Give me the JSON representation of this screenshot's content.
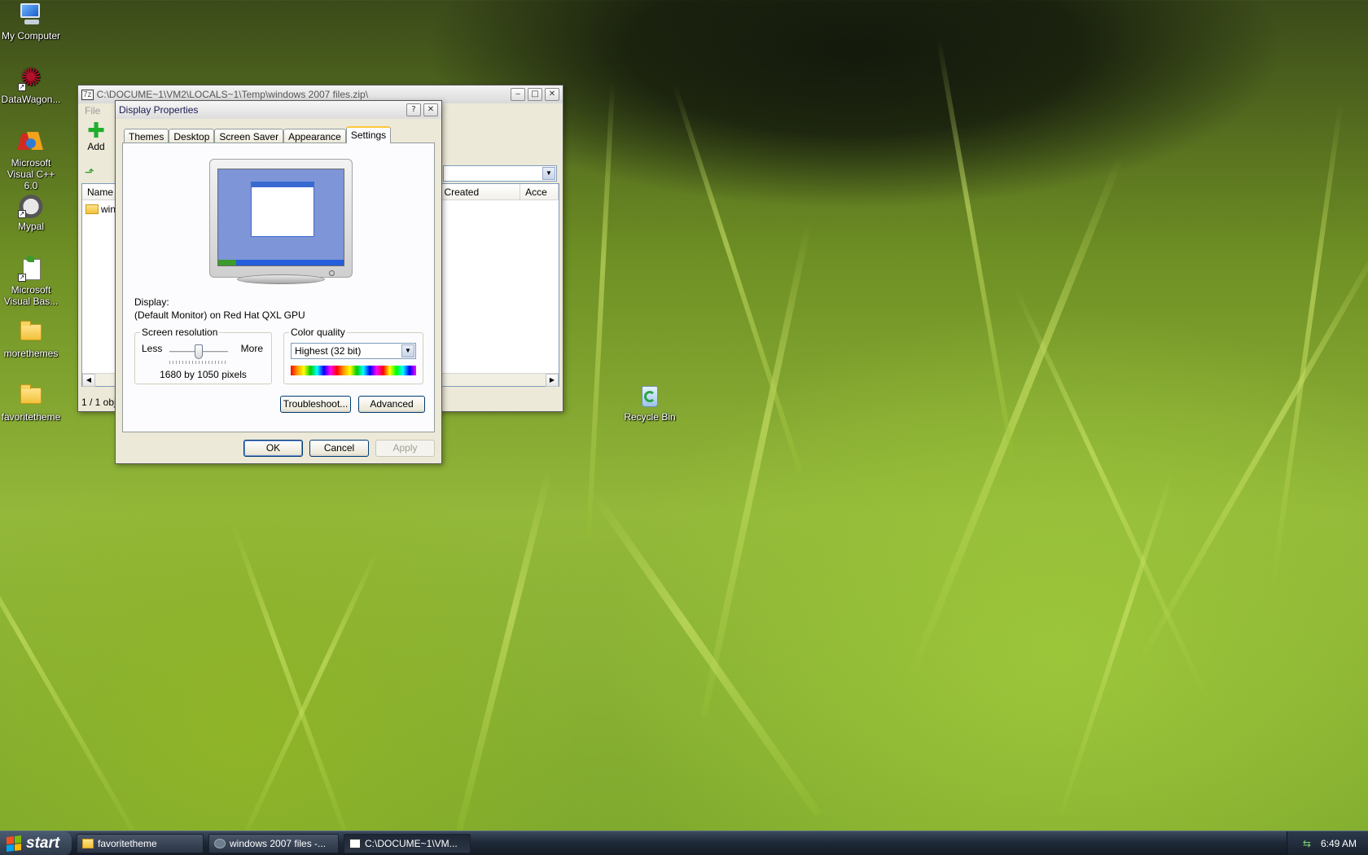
{
  "desktop": {
    "icons": [
      {
        "label": "My Computer",
        "icon": "computer-icon"
      },
      {
        "label": "DataWagon...",
        "icon": "datawagon-icon"
      },
      {
        "label": "Microsoft Visual C++ 6.0",
        "icon": "visual-cpp-icon"
      },
      {
        "label": "Mypal",
        "icon": "mypal-icon"
      },
      {
        "label": "Microsoft Visual Bas...",
        "icon": "visual-basic-icon"
      },
      {
        "label": "morethemes",
        "icon": "folder-icon"
      },
      {
        "label": "favoritetheme",
        "icon": "folder-icon"
      },
      {
        "label": "Recycle Bin",
        "icon": "recycle-bin-icon"
      }
    ]
  },
  "zip_window": {
    "title": "C:\\DOCUME~1\\VM2\\LOCALS~1\\Temp\\windows 2007 files.zip\\",
    "menu_first": "File",
    "toolbar_add": "Add",
    "columns": [
      "Name",
      "Created",
      "Acce"
    ],
    "row_name": "win",
    "status": "1 / 1 obj"
  },
  "dialog": {
    "title": "Display Properties",
    "help_glyph": "?",
    "close_glyph": "✕",
    "tabs": [
      "Themes",
      "Desktop",
      "Screen Saver",
      "Appearance",
      "Settings"
    ],
    "selected_tab": "Settings",
    "display_label": "Display:",
    "display_value": "(Default Monitor) on Red Hat QXL GPU",
    "screen_resolution": {
      "title": "Screen resolution",
      "less": "Less",
      "more": "More",
      "value_text": "1680 by 1050 pixels",
      "slider_position": 0.5
    },
    "color_quality": {
      "title": "Color quality",
      "selected": "Highest (32 bit)"
    },
    "buttons": {
      "troubleshoot": "Troubleshoot...",
      "advanced": "Advanced",
      "ok": "OK",
      "cancel": "Cancel",
      "apply": "Apply"
    }
  },
  "taskbar": {
    "start": "start",
    "items": [
      "favoritetheme",
      "windows 2007 files -...",
      "C:\\DOCUME~1\\VM..."
    ],
    "clock": "6:49 AM"
  }
}
